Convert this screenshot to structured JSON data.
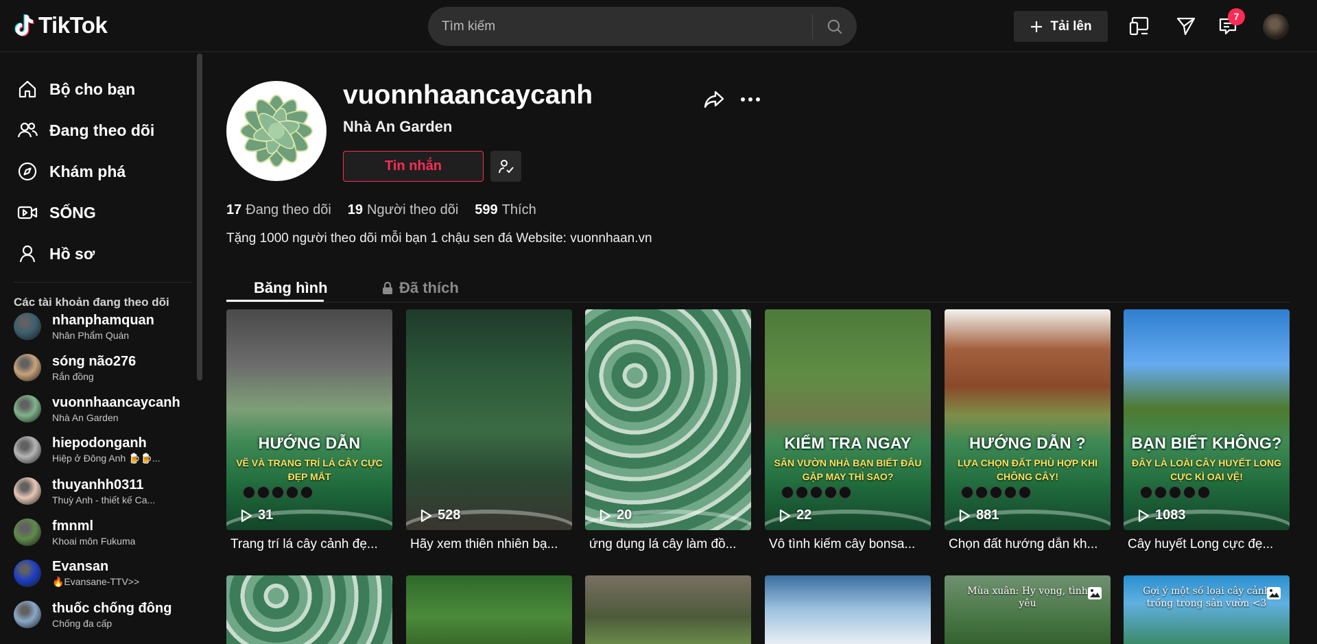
{
  "header": {
    "logo_text": "TikTok",
    "search_placeholder": "Tìm kiếm",
    "upload_label": "Tải lên",
    "inbox_count": "7"
  },
  "sidebar": {
    "nav": [
      {
        "label": "Bộ cho bạn",
        "icon": "home-icon"
      },
      {
        "label": "Đang theo dõi",
        "icon": "following-icon"
      },
      {
        "label": "Khám phá",
        "icon": "compass-icon"
      },
      {
        "label": "SỐNG",
        "icon": "live-icon"
      },
      {
        "label": "Hồ sơ",
        "icon": "profile-icon"
      }
    ],
    "following_heading": "Các tài khoản đang theo dõi",
    "accounts": [
      {
        "username": "nhanphamquan",
        "nickname": "Nhân Phẩm Quán",
        "color": "#3b5f6e"
      },
      {
        "username": "sóng não276",
        "nickname": "Rắn đồng",
        "color": "#c9a27a"
      },
      {
        "username": "vuonnhaancaycanh",
        "nickname": "Nhà An Garden",
        "color": "#7fb58a"
      },
      {
        "username": "hiepodonganh",
        "nickname": "Hiệp ở Đông Anh 🍺🍺...",
        "color": "#b5b5b5"
      },
      {
        "username": "thuyanhh0311",
        "nickname": "Thuỳ Anh - thiết kế Ca...",
        "color": "#e7c6b6"
      },
      {
        "username": "fmnml",
        "nickname": "Khoai môn Fukuma",
        "color": "#5f8c4a"
      },
      {
        "username": "Evansan",
        "nickname": "🔥Evansane-TTV>>",
        "color": "#1d3fc7"
      },
      {
        "username": "thuốc chống đông",
        "nickname": "Chống đa cấp",
        "color": "#8aa8c8"
      }
    ]
  },
  "profile": {
    "username": "vuonnhaancaycanh",
    "nickname": "Nhà An Garden",
    "message_label": "Tin nhắn",
    "following_count": "17",
    "following_label": "Đang theo dõi",
    "followers_count": "19",
    "followers_label": "Người theo dõi",
    "likes_count": "599",
    "likes_label": "Thích",
    "bio": "Tặng 1000 người theo dõi mỗi bạn 1 chậu sen đá Website: vuonnhaan.vn"
  },
  "tabs": {
    "videos": "Băng hình",
    "liked": "Đã thích"
  },
  "videos": [
    {
      "plays": "31",
      "caption": "Trang trí lá cây cảnh đẹ...",
      "title": "HƯỚNG DẪN",
      "subtitle": "VẼ VÀ TRANG TRÍ LÁ CÂY CỰC ĐẸP MẮT"
    },
    {
      "plays": "528",
      "caption": "Hãy xem thiên nhiên bạ...",
      "title": "",
      "subtitle": ""
    },
    {
      "plays": "20",
      "caption": "ứng dụng lá cây làm đồ...",
      "title": "",
      "subtitle": ""
    },
    {
      "plays": "22",
      "caption": "Vô tình kiếm cây bonsa...",
      "title": "KIỂM TRA NGAY",
      "subtitle": "SÂN VƯỜN NHÀ BẠN BIẾT ĐÂU GẶP MAY THÌ SAO?"
    },
    {
      "plays": "881",
      "caption": "Chọn đất hướng dẫn kh...",
      "title": "HƯỚNG DẪN ?",
      "subtitle": "LỰA CHỌN ĐẤT PHÙ HỢP KHI CHÔNG CÂY!"
    },
    {
      "plays": "1083",
      "caption": "Cây huyết Long cực đẹ...",
      "title": "BẠN BIẾT KHÔNG?",
      "subtitle": "ĐÂY LÀ LOÀI CÂY HUYẾT LONG CỰC KÌ OAI VỆ!"
    }
  ],
  "videos_row2": [
    {
      "text": ""
    },
    {
      "text": ""
    },
    {
      "text": ""
    },
    {
      "text": ""
    },
    {
      "text": "Mùa xuân: Hy vọng, tình yêu"
    },
    {
      "text": "Gợi ý một số loại cây cảnh trồng trong sân vườn <3"
    }
  ],
  "colors": {
    "accent": "#fe2c55",
    "background": "#121212"
  }
}
